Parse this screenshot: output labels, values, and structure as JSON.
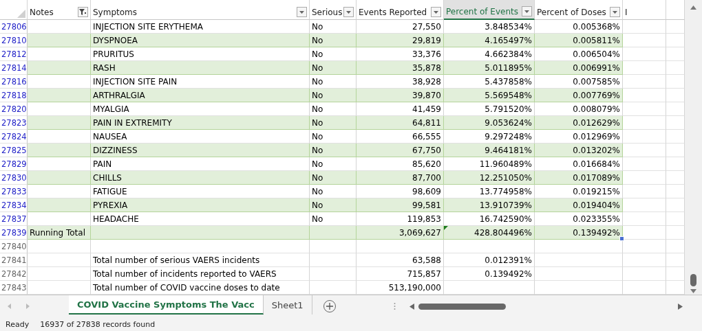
{
  "columns": [
    {
      "label": "Notes",
      "filtered": true,
      "selected": false
    },
    {
      "label": "Symptoms",
      "filtered": false,
      "selected": false
    },
    {
      "label": "Serious",
      "filtered": false,
      "selected": false
    },
    {
      "label": "Events Reported",
      "filtered": false,
      "selected": false
    },
    {
      "label": "Percent of Events",
      "filtered": false,
      "selected": true
    },
    {
      "label": "Percent of Doses",
      "filtered": false,
      "selected": false
    },
    {
      "label": "I",
      "selected": false
    }
  ],
  "rows": [
    {
      "kind": "record",
      "number": "27806",
      "symptom": "INJECTION SITE ERYTHEMA",
      "serious": "No",
      "events": "27,550",
      "pct_events": "3.848534%",
      "pct_doses": "0.005368%"
    },
    {
      "kind": "record",
      "number": "27810",
      "symptom": "DYSPNOEA",
      "serious": "No",
      "events": "29,819",
      "pct_events": "4.165497%",
      "pct_doses": "0.005811%"
    },
    {
      "kind": "record",
      "number": "27812",
      "symptom": "PRURITUS",
      "serious": "No",
      "events": "33,376",
      "pct_events": "4.662384%",
      "pct_doses": "0.006504%"
    },
    {
      "kind": "record",
      "number": "27814",
      "symptom": "RASH",
      "serious": "No",
      "events": "35,878",
      "pct_events": "5.011895%",
      "pct_doses": "0.006991%"
    },
    {
      "kind": "record",
      "number": "27816",
      "symptom": "INJECTION SITE PAIN",
      "serious": "No",
      "events": "38,928",
      "pct_events": "5.437858%",
      "pct_doses": "0.007585%"
    },
    {
      "kind": "record",
      "number": "27818",
      "symptom": "ARTHRALGIA",
      "serious": "No",
      "events": "39,870",
      "pct_events": "5.569548%",
      "pct_doses": "0.007769%"
    },
    {
      "kind": "record",
      "number": "27820",
      "symptom": "MYALGIA",
      "serious": "No",
      "events": "41,459",
      "pct_events": "5.791520%",
      "pct_doses": "0.008079%"
    },
    {
      "kind": "record",
      "number": "27823",
      "symptom": "PAIN IN EXTREMITY",
      "serious": "No",
      "events": "64,811",
      "pct_events": "9.053624%",
      "pct_doses": "0.012629%"
    },
    {
      "kind": "record",
      "number": "27824",
      "symptom": "NAUSEA",
      "serious": "No",
      "events": "66,555",
      "pct_events": "9.297248%",
      "pct_doses": "0.012969%"
    },
    {
      "kind": "record",
      "number": "27825",
      "symptom": "DIZZINESS",
      "serious": "No",
      "events": "67,750",
      "pct_events": "9.464181%",
      "pct_doses": "0.013202%"
    },
    {
      "kind": "record",
      "number": "27829",
      "symptom": "PAIN",
      "serious": "No",
      "events": "85,620",
      "pct_events": "11.960489%",
      "pct_doses": "0.016684%"
    },
    {
      "kind": "record",
      "number": "27830",
      "symptom": "CHILLS",
      "serious": "No",
      "events": "87,700",
      "pct_events": "12.251050%",
      "pct_doses": "0.017089%"
    },
    {
      "kind": "record",
      "number": "27833",
      "symptom": "FATIGUE",
      "serious": "No",
      "events": "98,609",
      "pct_events": "13.774958%",
      "pct_doses": "0.019215%"
    },
    {
      "kind": "record",
      "number": "27834",
      "symptom": "PYREXIA",
      "serious": "No",
      "events": "99,581",
      "pct_events": "13.910739%",
      "pct_doses": "0.019404%"
    },
    {
      "kind": "record",
      "number": "27837",
      "symptom": "HEADACHE",
      "serious": "No",
      "events": "119,853",
      "pct_events": "16.742590%",
      "pct_doses": "0.023355%"
    },
    {
      "kind": "total",
      "number": "27839",
      "notes": "Running Total",
      "events": "3,069,627",
      "pct_events": "428.804496%",
      "pct_doses": "0.139492%"
    },
    {
      "kind": "blank",
      "number": "27840"
    },
    {
      "kind": "summary",
      "number": "27841",
      "symptom": "Total number of serious VAERS incidents",
      "events": "63,588",
      "pct_events": "0.012391%"
    },
    {
      "kind": "summary",
      "number": "27842",
      "symptom": "Total number of incidents reported to VAERS",
      "events": "715,857",
      "pct_events": "0.139492%"
    },
    {
      "kind": "summary",
      "number": "27843",
      "symptom": "Total number of COVID vaccine doses to date",
      "events": "513,190,000"
    }
  ],
  "sheet_tabs": [
    {
      "label": "COVID Vaccine Symptoms The Vacc",
      "selected": true
    },
    {
      "label": "Sheet1",
      "selected": false
    }
  ],
  "status_bar": {
    "mode": "Ready",
    "message": "16937 of 27838 records found"
  }
}
